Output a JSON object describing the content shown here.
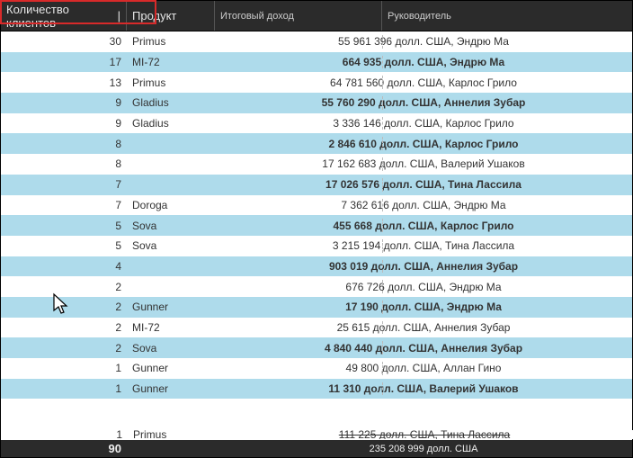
{
  "header": {
    "col0": "Количество клиентов",
    "col1": "Продукт",
    "col2": "Итоговый доход",
    "col3": "Руководитель"
  },
  "rows": [
    {
      "clients": "30",
      "product": "Primus",
      "combined": "55 961 396 долл. США, Эндрю Ма"
    },
    {
      "clients": "17",
      "product": "MI-72",
      "combined": "664 935 долл. США, Эндрю Ма"
    },
    {
      "clients": "13",
      "product": "Primus",
      "combined": "64 781 560 долл. США, Карлос Грило"
    },
    {
      "clients": "9",
      "product": "Gladius",
      "combined": "55 760 290 долл. США, Аннелия Зубар"
    },
    {
      "clients": "9",
      "product": "Gladius",
      "combined": "3 336 146 долл. США, Карлос Грило"
    },
    {
      "clients": "8",
      "product": "",
      "combined": "2 846 610 долл. США, Карлос Грило"
    },
    {
      "clients": "8",
      "product": "",
      "combined": "17 162 683 долл. США, Валерий Ушаков"
    },
    {
      "clients": "7",
      "product": "",
      "combined": "17 026 576 долл. США, Тина Лассила"
    },
    {
      "clients": "7",
      "product": "Doroga",
      "combined": "7 362 616 долл. США, Эндрю Ма"
    },
    {
      "clients": "5",
      "product": "Sova",
      "combined": "455 668 долл. США, Карлос Грило"
    },
    {
      "clients": "5",
      "product": "Sova",
      "combined": "3 215 194 долл. США, Тина Лассила"
    },
    {
      "clients": "4",
      "product": "",
      "combined": "903 019 долл. США, Аннелия Зубар"
    },
    {
      "clients": "2",
      "product": "",
      "combined": "676 726 долл. США, Эндрю Ма"
    },
    {
      "clients": "2",
      "product": "Gunner",
      "combined": "17 190 долл. США, Эндрю Ма"
    },
    {
      "clients": "2",
      "product": "MI-72",
      "combined": "25 615 долл. США, Аннелия Зубар"
    },
    {
      "clients": "2",
      "product": "Sova",
      "combined": "4 840 440 долл. США, Аннелия Зубар"
    },
    {
      "clients": "1",
      "product": "Gunner",
      "combined": "49 800 долл. США, Аллан Гино"
    },
    {
      "clients": "1",
      "product": "Gunner",
      "combined": "11 310 долл. США, Валерий Ушаков"
    },
    {
      "clients": "1",
      "product": "Primus",
      "combined": "111 225 долл. США, Тина Лассила"
    }
  ],
  "footer": {
    "total_clients": "90",
    "total_income": "235 208 999 долл. США"
  }
}
